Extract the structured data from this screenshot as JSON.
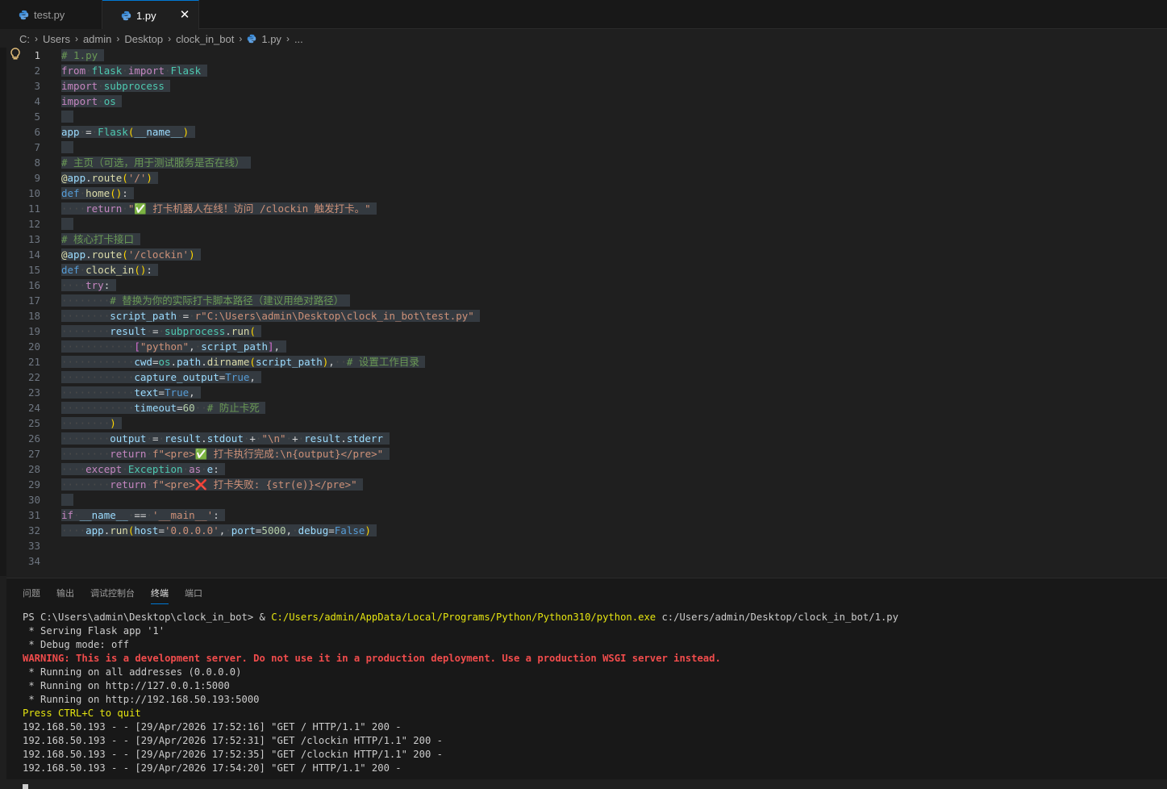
{
  "tabs": [
    {
      "label": "test.py",
      "active": false
    },
    {
      "label": "1.py",
      "active": true
    }
  ],
  "close_glyph": "✕",
  "breadcrumb": [
    "C:",
    "Users",
    "admin",
    "Desktop",
    "clock_in_bot",
    "1.py",
    "..."
  ],
  "panel": {
    "tabs": [
      "问题",
      "输出",
      "调试控制台",
      "终端",
      "端口"
    ],
    "active_tab": "终端"
  },
  "code_lines": [
    "# 1.py",
    "from flask import Flask",
    "import subprocess",
    "import os",
    "",
    "app = Flask(__name__)",
    "",
    "# 主页（可选，用于测试服务是否在线）",
    "@app.route('/')",
    "def home():",
    "    return \"✅ 打卡机器人在线！访问 /clockin 触发打卡。\"",
    "",
    "# 核心打卡接口",
    "@app.route('/clockin')",
    "def clock_in():",
    "    try:",
    "        # 替换为你的实际打卡脚本路径（建议用绝对路径）",
    "        script_path = r\"C:\\Users\\admin\\Desktop\\clock_in_bot\\test.py\"",
    "        result = subprocess.run(",
    "            [\"python\", script_path],",
    "            cwd=os.path.dirname(script_path),  # 设置工作目录",
    "            capture_output=True,",
    "            text=True,",
    "            timeout=60  # 防止卡死",
    "        )",
    "        output = result.stdout + \"\\n\" + result.stderr",
    "        return f\"<pre>✅ 打卡执行完成:\\n{output}</pre>\"",
    "    except Exception as e:",
    "        return f\"<pre>❌ 打卡失败: {str(e)}</pre>\"",
    "",
    "if __name__ == '__main__':",
    "    app.run(host='0.0.0.0', port=5000, debug=False)",
    "",
    ""
  ],
  "terminal": {
    "prompt": "PS C:\\Users\\admin\\Desktop\\clock_in_bot> ",
    "cmd_amp": "& ",
    "cmd_exe": "C:/Users/admin/AppData/Local/Programs/Python/Python310/python.exe",
    "cmd_arg": " c:/Users/admin/Desktop/clock_in_bot/1.py",
    "lines": [
      " * Serving Flask app '1'",
      " * Debug mode: off"
    ],
    "warning": "WARNING: This is a development server. Do not use it in a production deployment. Use a production WSGI server instead.",
    "lines2": [
      " * Running on all addresses (0.0.0.0)",
      " * Running on http://127.0.0.1:5000",
      " * Running on http://192.168.50.193:5000"
    ],
    "quit_hint": "Press CTRL+C to quit",
    "log": [
      "192.168.50.193 - - [29/Apr/2026 17:52:16] \"GET / HTTP/1.1\" 200 -",
      "192.168.50.193 - - [29/Apr/2026 17:52:31] \"GET /clockin HTTP/1.1\" 200 -",
      "192.168.50.193 - - [29/Apr/2026 17:52:35] \"GET /clockin HTTP/1.1\" 200 -",
      "192.168.50.193 - - [29/Apr/2026 17:54:20] \"GET / HTTP/1.1\" 200 -"
    ]
  },
  "colors": {
    "accent": "#0078d4",
    "warning": "#f14c4c",
    "terminal_yellow": "#e5e510"
  }
}
